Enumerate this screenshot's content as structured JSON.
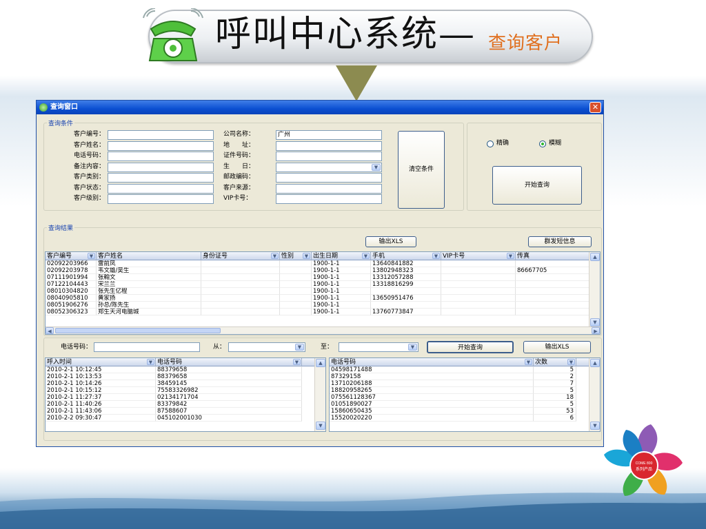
{
  "header": {
    "title_main": "呼叫中心系统—",
    "title_sub": "查询客户"
  },
  "window": {
    "title": "查询窗口",
    "close_glyph": "✕"
  },
  "conditions": {
    "legend": "查询条件",
    "left_fields": [
      {
        "label": "客户编号：",
        "value": ""
      },
      {
        "label": "客户姓名：",
        "value": ""
      },
      {
        "label": "电话号码：",
        "value": ""
      },
      {
        "label": "备注内容：",
        "value": ""
      },
      {
        "label": "客户类别：",
        "value": ""
      },
      {
        "label": "客户状态：",
        "value": ""
      },
      {
        "label": "客户级别：",
        "value": ""
      }
    ],
    "right_fields": [
      {
        "label": "公司名称：",
        "value": "广州"
      },
      {
        "label": "地　　址：",
        "value": ""
      },
      {
        "label": "证件号码：",
        "value": ""
      },
      {
        "label": "生　　日：",
        "value": ""
      },
      {
        "label": "邮政编码：",
        "value": ""
      },
      {
        "label": "客户来源：",
        "value": ""
      },
      {
        "label": "VIP卡号：",
        "value": ""
      }
    ],
    "clear_button": "清空条件",
    "radio_exact": "精确",
    "radio_fuzzy": "模糊",
    "selected_mode": "模糊",
    "search_button": "开始查询"
  },
  "results": {
    "legend": "查询结果",
    "export_button": "输出XLS",
    "sms_button": "群发短信息",
    "columns": [
      "客户编号",
      "客户姓名",
      "身份证号",
      "性别",
      "出生日期",
      "手机",
      "VIP卡号",
      "传真"
    ],
    "rows": [
      [
        "02092203966",
        "雷前凤",
        "",
        "",
        "1900-1-1",
        "13640841882",
        "",
        ""
      ],
      [
        "02092203978",
        "韦文雄/吴生",
        "",
        "",
        "1900-1-1",
        "13802948323",
        "",
        "86667705"
      ],
      [
        "07111901994",
        "张翰文",
        "",
        "",
        "1900-1-1",
        "13312057288",
        "",
        ""
      ],
      [
        "07122104443",
        "宋兰兰",
        "",
        "",
        "1900-1-1",
        "13318816299",
        "",
        ""
      ],
      [
        "08010304820",
        "张先生亿程",
        "",
        "",
        "1900-1-1",
        "",
        "",
        ""
      ],
      [
        "08040905810",
        "黄家扬",
        "",
        "",
        "1900-1-1",
        "13650951476",
        "",
        ""
      ],
      [
        "08051906276",
        "孙总/陈先生",
        "",
        "",
        "1900-1-1",
        "",
        "",
        ""
      ],
      [
        "08052306323",
        "郑生天河电脑城",
        "",
        "",
        "1900-1-1",
        "13760773847",
        "",
        ""
      ]
    ]
  },
  "calls": {
    "phone_label": "电话号码：",
    "phone_value": "",
    "from_label": "从：",
    "from_value": "",
    "to_label": "至：",
    "to_value": "",
    "search_button": "开始查询",
    "export_button": "输出XLS",
    "left_columns": [
      "呼入时间",
      "电话号码"
    ],
    "left_rows": [
      [
        "2010-2-1 10:12:45",
        "88379658"
      ],
      [
        "2010-2-1 10:13:53",
        "88379658"
      ],
      [
        "2010-2-1 10:14:26",
        "38459145"
      ],
      [
        "2010-2-1 10:15:12",
        "75583326982"
      ],
      [
        "2010-2-1 11:27:37",
        "02134171704"
      ],
      [
        "2010-2-1 11:40:26",
        "83379842"
      ],
      [
        "2010-2-1 11:43:06",
        "87588607"
      ],
      [
        "2010-2-2 09:30:47",
        "045102001030"
      ]
    ],
    "right_columns": [
      "电话号码",
      "次数"
    ],
    "right_rows": [
      [
        "04598171488",
        "5"
      ],
      [
        "87329158",
        "2"
      ],
      [
        "13710206188",
        "7"
      ],
      [
        "18820958265",
        "5"
      ],
      [
        "075561128367",
        "18"
      ],
      [
        "01051890027",
        "5"
      ],
      [
        "15860650435",
        "53"
      ],
      [
        "15520020220",
        "6"
      ]
    ]
  },
  "logo": {
    "center_line1": "COME 800",
    "center_line2": "系列产品"
  },
  "colors": {
    "title_sub": "#e07020",
    "titlebar": "#0b4fd1",
    "legend": "#1843b0",
    "arrow": "#8c8b50"
  }
}
